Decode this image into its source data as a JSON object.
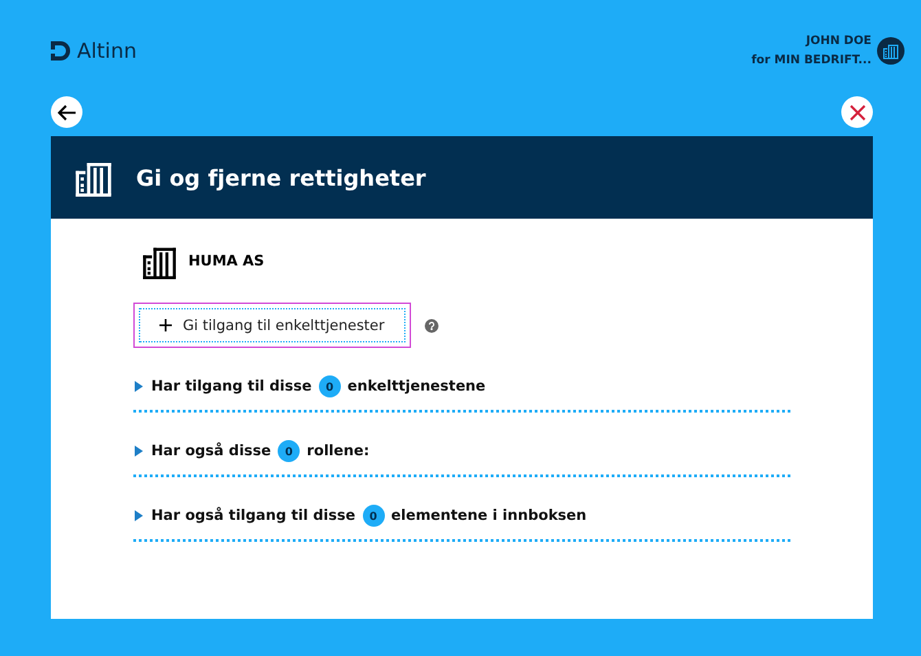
{
  "header": {
    "logo": "Altinn",
    "user_name": "JOHN DOE",
    "user_org": "for MIN BEDRIFT..."
  },
  "panel": {
    "title": "Gi og fjerne rettigheter",
    "organization": "HUMA AS",
    "add_button": "Gi tilgang til enkelttjenester",
    "sections": [
      {
        "before": "Har tilgang til disse",
        "count": "0",
        "after": "enkelttjenestene",
        "expanded": false
      },
      {
        "before": "Har også disse",
        "count": "0",
        "after": "rollene:",
        "expanded": false
      },
      {
        "before": "Har også tilgang til disse",
        "count": "0",
        "after": "elementene i innboksen",
        "expanded": false
      }
    ]
  }
}
